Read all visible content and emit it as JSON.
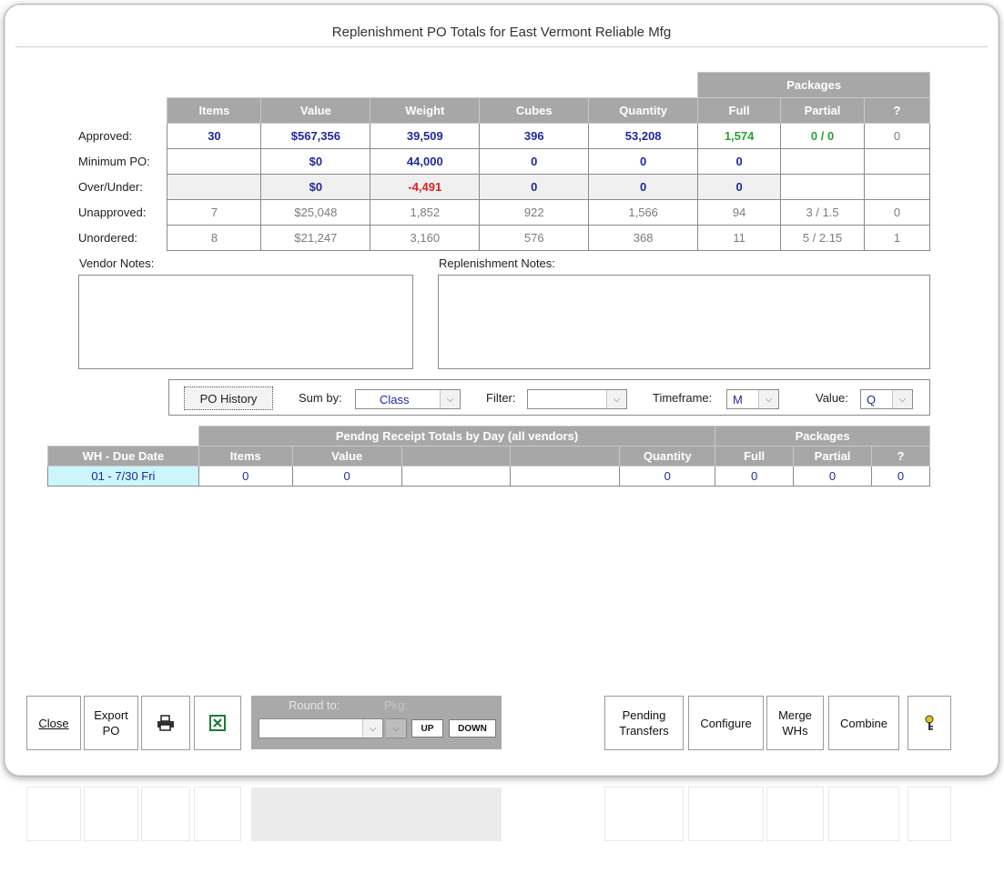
{
  "window": {
    "title": "Replenishment PO Totals for East Vermont Reliable Mfg"
  },
  "totals": {
    "packages_header": "Packages",
    "columns": [
      "Items",
      "Value",
      "Weight",
      "Cubes",
      "Quantity",
      "Full",
      "Partial",
      "?"
    ],
    "rows": [
      {
        "label": "Approved:",
        "cells": [
          "30",
          "$567,356",
          "39,509",
          "396",
          "53,208",
          "1,574",
          "0 / 0",
          "0"
        ]
      },
      {
        "label": "Minimum PO:",
        "cells": [
          "",
          "$0",
          "44,000",
          "0",
          "0",
          "0",
          "",
          ""
        ]
      },
      {
        "label": "Over/Under:",
        "cells": [
          "",
          "$0",
          "-4,491",
          "0",
          "0",
          "0",
          "",
          ""
        ]
      },
      {
        "label": "Unapproved:",
        "cells": [
          "7",
          "$25,048",
          "1,852",
          "922",
          "1,566",
          "94",
          "3 / 1.5",
          "0"
        ]
      },
      {
        "label": "Unordered:",
        "cells": [
          "8",
          "$21,247",
          "3,160",
          "576",
          "368",
          "11",
          "5 / 2.15",
          "1"
        ]
      }
    ]
  },
  "notes": {
    "vendor_label": "Vendor Notes:",
    "replenishment_label": "Replenishment Notes:"
  },
  "filters": {
    "po_history_label": "PO History",
    "sum_by_label": "Sum by:",
    "sum_by_value": "Class",
    "filter_label": "Filter:",
    "filter_value": "",
    "timeframe_label": "Timeframe:",
    "timeframe_value": "M",
    "value_label": "Value:",
    "value_value": "Q"
  },
  "pending": {
    "title": "Pendng Receipt Totals by Day (all vendors)",
    "packages_header": "Packages",
    "columns": [
      "WH - Due Date",
      "Items",
      "Value",
      "",
      "",
      "Quantity",
      "Full",
      "Partial",
      "?"
    ],
    "rows": [
      {
        "cells": [
          "01 - 7/30 Fri",
          "0",
          "0",
          "",
          "",
          "0",
          "0",
          "0",
          "0"
        ]
      }
    ]
  },
  "buttons": {
    "close": "Close",
    "export_po_line1": "Export",
    "export_po_line2": "PO",
    "print_icon": "printer-icon",
    "excel_icon": "excel-icon",
    "round_to_label": "Round to:",
    "pkg_label": "Pkg:",
    "round_to_value": "",
    "up": "UP",
    "down": "DOWN",
    "pending_transfers_line1": "Pending",
    "pending_transfers_line2": "Transfers",
    "configure": "Configure",
    "merge_whs_line1": "Merge",
    "merge_whs_line2": "WHs",
    "combine": "Combine",
    "help_icon": "key-icon"
  },
  "colors": {
    "header_gray": "#a7a7a7",
    "value_blue": "#1f2a9c",
    "negative_red": "#e02020",
    "positive_green": "#25a32b",
    "wh_cell_cyan": "#ccf6fb"
  }
}
